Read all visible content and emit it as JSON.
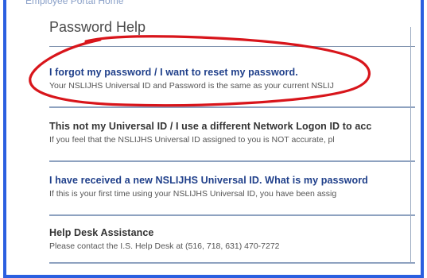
{
  "breadcrumb": "Employee Portal Home",
  "page_title": "Password Help",
  "sections": [
    {
      "heading": "I forgot my password / I want to reset my password.",
      "text": "Your NSLIJHS Universal ID and Password is the same as your current NSLIJ"
    },
    {
      "heading": "This not my Universal ID / I use a different Network Logon ID to acc",
      "text": "If you feel that the NSLIJHS Universal ID assigned to you is NOT accurate, pl"
    },
    {
      "heading": "I have received a new NSLIJHS Universal ID. What is my password",
      "text": "If this is your first time using your NSLIJHS Universal ID, you have been assig"
    },
    {
      "heading": "Help Desk Assistance",
      "text": "Please contact the I.S. Help Desk at (516, 718, 631) 470-7272"
    }
  ],
  "colors": {
    "frame_border": "#2b5fe0",
    "link_heading": "#1f3f8a",
    "annotation": "#d8151b"
  }
}
